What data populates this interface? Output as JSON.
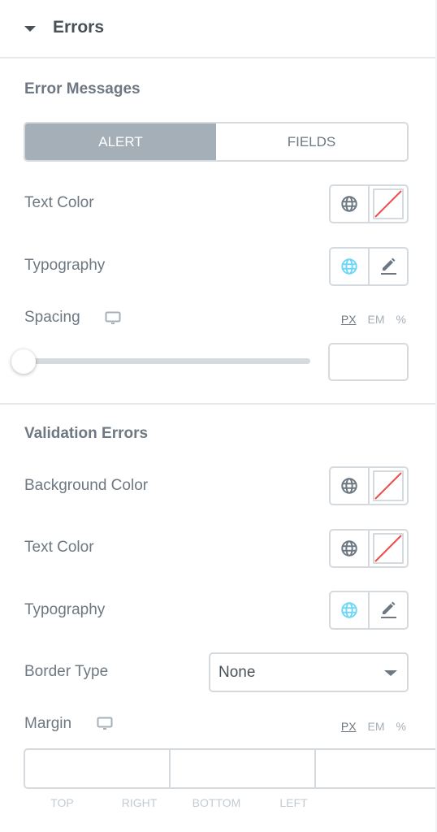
{
  "section": {
    "title": "Errors",
    "expanded": true
  },
  "error_messages": {
    "heading": "Error Messages",
    "tabs": [
      {
        "label": "ALERT",
        "active": true
      },
      {
        "label": "FIELDS",
        "active": false
      }
    ],
    "text_color": {
      "label": "Text Color"
    },
    "typography": {
      "label": "Typography"
    },
    "spacing": {
      "label": "Spacing",
      "units": [
        "PX",
        "EM",
        "%"
      ],
      "selected_unit": "PX",
      "value": ""
    }
  },
  "validation_errors": {
    "heading": "Validation Errors",
    "background_color": {
      "label": "Background Color"
    },
    "text_color": {
      "label": "Text Color"
    },
    "typography": {
      "label": "Typography"
    },
    "border_type": {
      "label": "Border Type",
      "value": "None"
    },
    "margin": {
      "label": "Margin",
      "units": [
        "PX",
        "EM",
        "%"
      ],
      "selected_unit": "PX",
      "fields": [
        {
          "label": "TOP",
          "value": ""
        },
        {
          "label": "RIGHT",
          "value": ""
        },
        {
          "label": "BOTTOM",
          "value": ""
        },
        {
          "label": "LEFT",
          "value": ""
        }
      ],
      "linked": true
    }
  },
  "colors": {
    "accent_globe": "#71d7f7",
    "active_tab": "#a4afb7",
    "no_color_slash": "#f04c4c"
  }
}
